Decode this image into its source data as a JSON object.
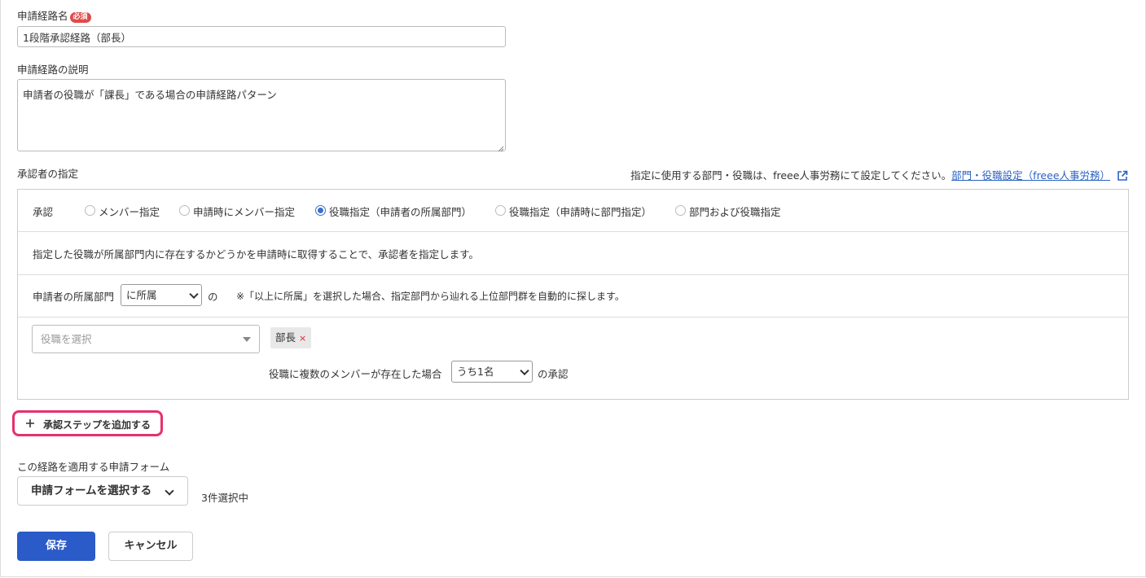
{
  "route_name": {
    "label": "申請経路名",
    "required_badge": "必須",
    "value": "1段階承認経路（部長）"
  },
  "route_description": {
    "label": "申請経路の説明",
    "value": "申請者の役職が「課長」である場合の申請経路パターン"
  },
  "approver": {
    "section_label": "承認者の指定",
    "help_text": "指定に使用する部門・役職は、freee人事労務にて設定してください。",
    "help_link": "部門・役職設定（freee人事労務）",
    "step": {
      "row_label": "承認",
      "options": [
        {
          "label": "メンバー指定",
          "selected": false
        },
        {
          "label": "申請時にメンバー指定",
          "selected": false
        },
        {
          "label": "役職指定（申請者の所属部門）",
          "selected": true
        },
        {
          "label": "役職指定（申請時に部門指定）",
          "selected": false
        },
        {
          "label": "部門および役職指定",
          "selected": false
        }
      ],
      "description": "指定した役職が所属部門内に存在するかどうかを申請時に取得することで、承認者を指定します。",
      "dept_prefix": "申請者の所属部門",
      "dept_select_value": "に所属",
      "dept_suffix": "の",
      "dept_note": "※「以上に所属」を選択した場合、指定部門から辿れる上位部門群を自動的に探します。",
      "role_select_placeholder": "役職を選択",
      "selected_roles": [
        "部長"
      ],
      "tag_remove_symbol": "×",
      "multiple_label": "役職に複数のメンバーが存在した場合",
      "multiple_select_value": "うち1名",
      "multiple_suffix": "の承認"
    },
    "add_step_button": "承認ステップを追加する",
    "add_step_icon": "plus-icon"
  },
  "forms": {
    "label": "この経路を適用する申請フォーム",
    "select_button": "申請フォームを選択する",
    "selected_count": "3件選択中"
  },
  "actions": {
    "save": "保存",
    "cancel": "キャンセル"
  },
  "colors": {
    "primary": "#2b5bc9",
    "accent_highlight": "#e8306b",
    "required": "#e04a4a",
    "link": "#2a62c4"
  }
}
